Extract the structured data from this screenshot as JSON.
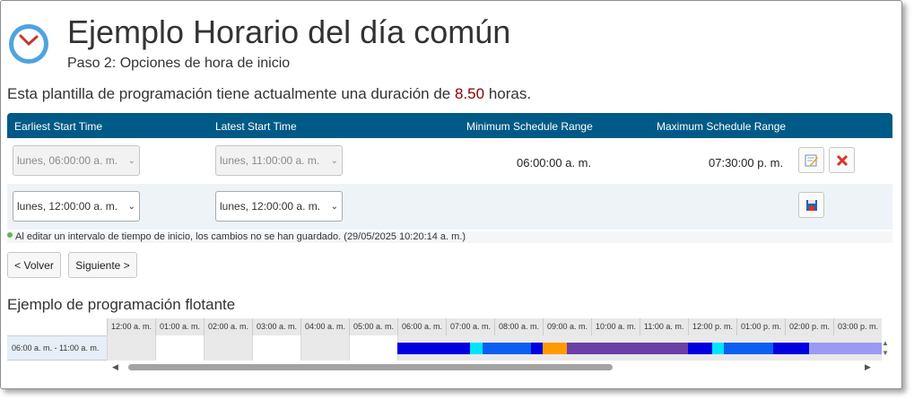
{
  "header": {
    "title": "Ejemplo Horario del día común",
    "subtitle": "Paso 2: Opciones de hora de inicio"
  },
  "summary": {
    "prefix": "Esta plantilla de programación tiene actualmente una duración de",
    "hours": "8.50",
    "suffix": "horas."
  },
  "table": {
    "headers": [
      "Earliest Start Time",
      "Latest Start Time",
      "Minimum Schedule Range",
      "Maximum Schedule Range"
    ],
    "rows": [
      {
        "earliest": "lunes, 06:00:00 a. m.",
        "latest": "lunes, 11:00:00 a. m.",
        "min": "06:00:00 a. m.",
        "max": "07:30:00 p. m."
      },
      {
        "earliest": "lunes, 12:00:00 a. m.",
        "latest": "lunes, 12:00:00 a. m."
      }
    ],
    "icons": {
      "edit": "edit-icon",
      "delete": "delete-icon",
      "save": "save-icon"
    }
  },
  "note": "Al editar un intervalo de tiempo de inicio, los cambios no se han guardado. (29/05/2025 10:20:14 a. m.)",
  "buttons": {
    "back": "< Volver",
    "next": "Siguiente >"
  },
  "floating": {
    "title": "Ejemplo de programación flotante",
    "hours": [
      "12:00 a. m.",
      "01:00 a. m.",
      "02:00 a. m.",
      "03:00 a. m.",
      "04:00 a. m.",
      "05:00 a. m.",
      "06:00 a. m.",
      "07:00 a. m.",
      "08:00 a. m.",
      "09:00 a. m.",
      "10:00 a. m.",
      "11:00 a. m.",
      "12:00 p. m.",
      "01:00 p. m.",
      "02:00 p. m.",
      "03:00 p. m."
    ],
    "row_label": "06:00 a. m. - 11:00 a. m.",
    "colors": {
      "blue": "#0000e0",
      "cyan": "#00e5ff",
      "light_blue": "#0b5ff0",
      "orange": "#ff9a00",
      "purple": "#6a3fa8",
      "lavender": "#9a9af5"
    }
  }
}
